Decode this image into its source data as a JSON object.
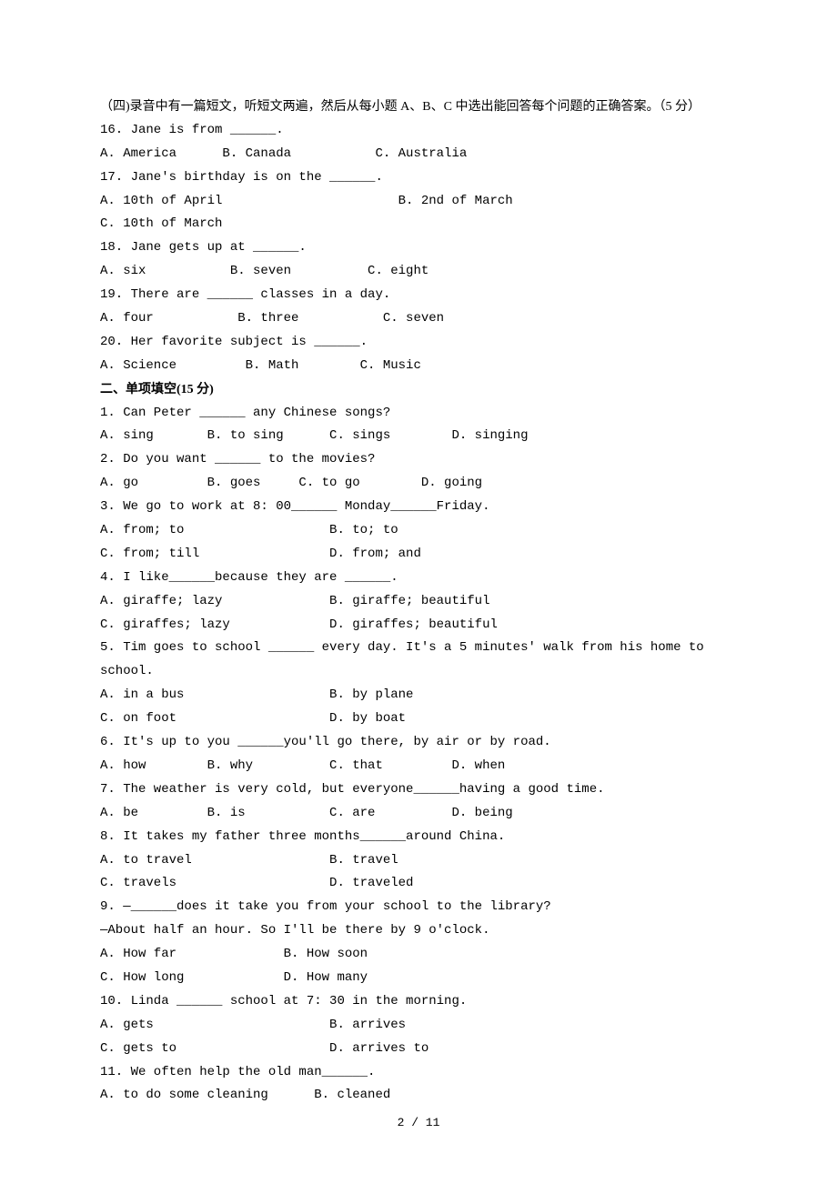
{
  "section4": {
    "instruction": "（四)录音中有一篇短文，听短文两遍，然后从每小题 A、B、C 中选出能回答每个问题的正确答案。（5 分）",
    "q16": {
      "text": "16. Jane is from ______.",
      "opts": "A. America      B. Canada           C. Australia"
    },
    "q17": {
      "text": "17. Jane's birthday is on the ______.",
      "optA": "A. 10th of April",
      "optB": "B. 2nd of March",
      "optC": "C. 10th of March"
    },
    "q18": {
      "text": "18. Jane gets up at ______.",
      "opts": "A. six           B. seven          C. eight"
    },
    "q19": {
      "text": "19. There are ______ classes in a day.",
      "opts": "A. four           B. three           C. seven"
    },
    "q20": {
      "text": "20. Her favorite subject is ______.",
      "opts": "A. Science         B. Math        C. Music"
    }
  },
  "section2": {
    "title": "二、单项填空(15 分)",
    "q1": {
      "text": "1. Can Peter ______ any Chinese songs?",
      "opts": "A. sing       B. to sing      C. sings        D. singing"
    },
    "q2": {
      "text": "2. Do you want ______ to the movies?",
      "opts": "A. go         B. goes     C. to go        D. going"
    },
    "q3": {
      "text": "3. We go to work at 8: 00______ Monday______Friday.",
      "optsAB": "A. from; to                   B. to; to",
      "optsCD": "C. from; till                 D. from; and"
    },
    "q4": {
      "text": "4. I like______because they are ______.",
      "optsAB": "A. giraffe; lazy              B. giraffe; beautiful",
      "optsCD": "C. giraffes; lazy             D. giraffes; beautiful"
    },
    "q5": {
      "text1": "5. Tim goes to school ______ every day. It's a 5 minutes' walk from his home to",
      "text2": "school.",
      "optsAB": "A. in a bus                   B. by plane",
      "optsCD": "C. on foot                    D. by boat"
    },
    "q6": {
      "text": "6. It's up to you ______you'll go there, by air or by road.",
      "opts": "A. how        B. why          C. that         D. when"
    },
    "q7": {
      "text": "7. The weather is very cold, but everyone______having a good time.",
      "opts": "A. be         B. is           C. are          D. being"
    },
    "q8": {
      "text": "8. It takes my father three months______around China.",
      "optsAB": "A. to travel                  B. travel",
      "optsCD": "C. travels                    D. traveled"
    },
    "q9": {
      "text1": "9. —______does it take you from your school to the library?",
      "text2": "—About half an hour. So I'll be there by 9 o'clock.",
      "optsAB": "A. How far              B. How soon",
      "optsCD": "C. How long             D. How many"
    },
    "q10": {
      "text": "10. Linda ______ school at 7: 30 in the morning.",
      "optsAB": "A. gets                       B. arrives",
      "optsCD": "C. gets to                    D. arrives to"
    },
    "q11": {
      "text": "11. We often help the old man______.",
      "optsAB": "A. to do some cleaning      B. cleaned"
    }
  },
  "page_number": "2 / 11"
}
